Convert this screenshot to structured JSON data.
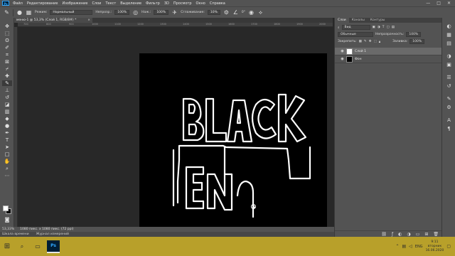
{
  "app": {
    "logo": "Ps"
  },
  "menu": {
    "items": [
      "Файл",
      "Редактирование",
      "Изображение",
      "Слои",
      "Текст",
      "Выделение",
      "Фильтр",
      "3D",
      "Просмотр",
      "Окно",
      "Справка"
    ],
    "controls": [
      "—",
      "□",
      "✕"
    ]
  },
  "options": {
    "mode_label": "Режим:",
    "mode_value": "Нормальный",
    "opacity_label": "Непрозр.:",
    "opacity_value": "100%",
    "pressure_label": "Наж.:",
    "pressure_value": "100%",
    "smoothing_label": "Сглаживание:",
    "smoothing_value": "10%",
    "angle_value": "0°"
  },
  "document": {
    "tab_title": "меню-1 @ 53,3% (Слой 1, RGB/8#) *",
    "tab_close": "×",
    "artwork_text": [
      "BLACK",
      "EN"
    ]
  },
  "rulers": {
    "h_ticks": [
      "700",
      "800",
      "900",
      "1000",
      "1100",
      "1200",
      "1300",
      "1400",
      "1500",
      "1600",
      "1700",
      "1800",
      "1900",
      "2000"
    ]
  },
  "status": {
    "zoom": "53,33%",
    "doc_info": "1080 пикс. x 1080 пикс. (72 ppi)"
  },
  "timeline": {
    "tabs": [
      "Шкала времени",
      "Журнал измерений"
    ]
  },
  "layers_panel": {
    "tabs": [
      "Слои",
      "Каналы",
      "Контуры"
    ],
    "search_placeholder": "Вид",
    "blend_mode": "Обычные",
    "opacity_label": "Непрозрачность:",
    "opacity_value": "100%",
    "lock_label": "Закрепить:",
    "fill_label": "Заливка:",
    "fill_value": "100%",
    "layers": [
      {
        "name": "Слой 1",
        "selected": true,
        "thumb": "#ffffff"
      },
      {
        "name": "Фон",
        "selected": false,
        "thumb": "#000000"
      }
    ]
  },
  "taskbar": {
    "lang": "ENG",
    "time": "9:11",
    "weekday": "вторник",
    "date": "16.06.2020"
  },
  "colors": {
    "fg": "#ffffff",
    "bg": "#000000",
    "taskbar": "#b8a02a"
  }
}
